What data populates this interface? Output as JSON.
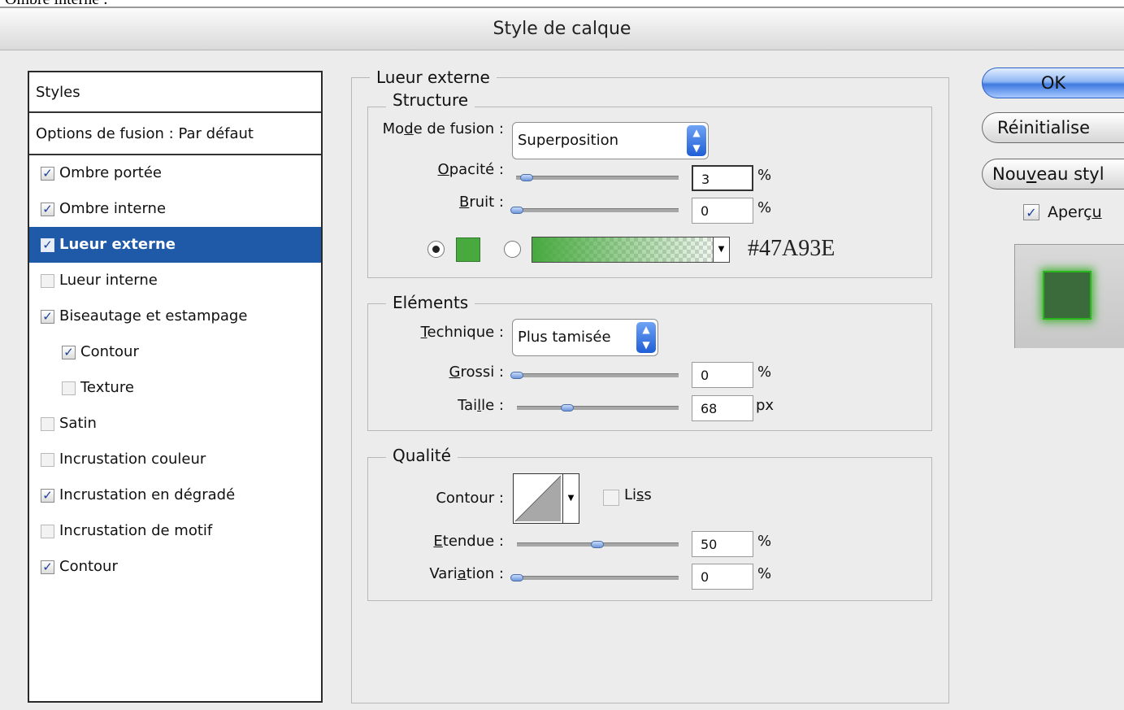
{
  "caption": "Ombre interne :",
  "dialog": {
    "title": "Style de calque"
  },
  "styles_panel": {
    "header": "Styles",
    "blend_options": "Options de fusion : Par défaut",
    "items": [
      {
        "label": "Ombre portée",
        "checked": true,
        "indent": false,
        "selected": false
      },
      {
        "label": "Ombre interne",
        "checked": true,
        "indent": false,
        "selected": false
      },
      {
        "label": "Lueur externe",
        "checked": true,
        "indent": false,
        "selected": true
      },
      {
        "label": "Lueur interne",
        "checked": false,
        "indent": false,
        "selected": false
      },
      {
        "label": "Biseautage et estampage",
        "checked": true,
        "indent": false,
        "selected": false
      },
      {
        "label": "Contour",
        "checked": true,
        "indent": true,
        "selected": false
      },
      {
        "label": "Texture",
        "checked": false,
        "indent": true,
        "selected": false
      },
      {
        "label": "Satin",
        "checked": false,
        "indent": false,
        "selected": false
      },
      {
        "label": "Incrustation couleur",
        "checked": false,
        "indent": false,
        "selected": false
      },
      {
        "label": "Incrustation en dégradé",
        "checked": true,
        "indent": false,
        "selected": false
      },
      {
        "label": "Incrustation de motif",
        "checked": false,
        "indent": false,
        "selected": false
      },
      {
        "label": "Contour",
        "checked": true,
        "indent": false,
        "selected": false
      }
    ]
  },
  "main": {
    "section_title": "Lueur externe",
    "structure": {
      "title": "Structure",
      "blend_mode_label_pre": "Mo",
      "blend_mode_label_key": "d",
      "blend_mode_label_post": "e de fusion :",
      "blend_mode_value": "Superposition",
      "opacity_label_key": "O",
      "opacity_label_post": "pacité :",
      "opacity_value": "3",
      "opacity_unit": "%",
      "noise_label_key": "B",
      "noise_label_post": "ruit :",
      "noise_value": "0",
      "noise_unit": "%",
      "color_hex": "#47A93E",
      "color_mode": "solid"
    },
    "elements": {
      "title": "Eléments",
      "technique_label_key": "T",
      "technique_label_post": "echnique :",
      "technique_value": "Plus tamisée",
      "spread_label_key": "G",
      "spread_label_post": "rossi :",
      "spread_value": "0",
      "spread_unit": "%",
      "size_label_pre": "Tai",
      "size_label_key": "l",
      "size_label_post": "le :",
      "size_value": "68",
      "size_unit": "px"
    },
    "quality": {
      "title": "Qualité",
      "contour_label": "Contour :",
      "smooth_label_pre": "Li",
      "smooth_label_key": "s",
      "smooth_label_post": "s",
      "smooth_checked": false,
      "range_label_key": "E",
      "range_label_post": "tendue :",
      "range_value": "50",
      "range_unit": "%",
      "jitter_label_pre": "Vari",
      "jitter_label_key": "a",
      "jitter_label_post": "tion :",
      "jitter_value": "0",
      "jitter_unit": "%"
    }
  },
  "buttons": {
    "ok": "OK",
    "reset": "Réinitialise",
    "new_style_pre": "Nou",
    "new_style_key": "v",
    "new_style_post": "eau styl",
    "preview_label_pre": "Aperç",
    "preview_label_key": "u",
    "preview_checked": true
  },
  "colors": {
    "accent": "#1f5aa8",
    "glow": "#47A93E"
  }
}
